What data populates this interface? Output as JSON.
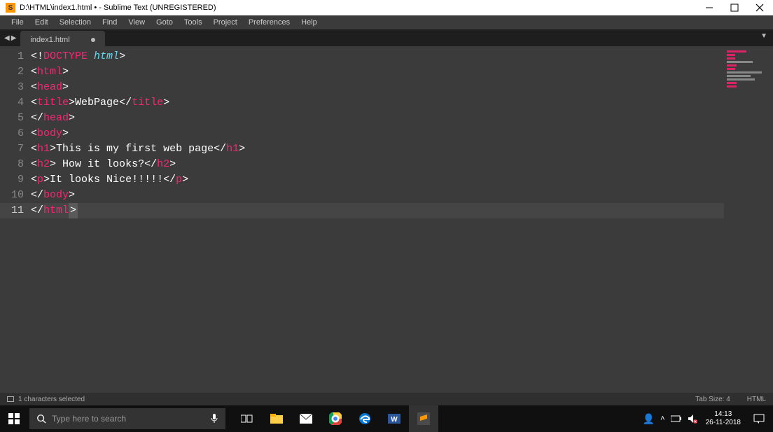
{
  "titlebar": {
    "title": "D:\\HTML\\index1.html • - Sublime Text (UNREGISTERED)",
    "app_icon_letter": "S"
  },
  "menubar": {
    "items": [
      "File",
      "Edit",
      "Selection",
      "Find",
      "View",
      "Goto",
      "Tools",
      "Project",
      "Preferences",
      "Help"
    ]
  },
  "tabs": {
    "active": {
      "label": "index1.html",
      "modified": true
    }
  },
  "code": {
    "lines": [
      {
        "n": 1,
        "tokens": [
          {
            "t": "<!",
            "c": "punc"
          },
          {
            "t": "DOCTYPE",
            "c": "tag"
          },
          {
            "t": " ",
            "c": "w"
          },
          {
            "t": "html",
            "c": "doctype"
          },
          {
            "t": ">",
            "c": "punc"
          }
        ]
      },
      {
        "n": 2,
        "tokens": [
          {
            "t": "<",
            "c": "punc"
          },
          {
            "t": "html",
            "c": "tag"
          },
          {
            "t": ">",
            "c": "punc"
          }
        ]
      },
      {
        "n": 3,
        "tokens": [
          {
            "t": "<",
            "c": "punc"
          },
          {
            "t": "head",
            "c": "tag"
          },
          {
            "t": ">",
            "c": "punc"
          }
        ]
      },
      {
        "n": 4,
        "tokens": [
          {
            "t": "<",
            "c": "punc"
          },
          {
            "t": "title",
            "c": "tag"
          },
          {
            "t": ">",
            "c": "punc"
          },
          {
            "t": "WebPage",
            "c": "w"
          },
          {
            "t": "</",
            "c": "punc"
          },
          {
            "t": "title",
            "c": "tag"
          },
          {
            "t": ">",
            "c": "punc"
          }
        ]
      },
      {
        "n": 5,
        "tokens": [
          {
            "t": "</",
            "c": "punc"
          },
          {
            "t": "head",
            "c": "tag"
          },
          {
            "t": ">",
            "c": "punc"
          }
        ]
      },
      {
        "n": 6,
        "tokens": [
          {
            "t": "<",
            "c": "punc"
          },
          {
            "t": "body",
            "c": "tag"
          },
          {
            "t": ">",
            "c": "punc"
          }
        ]
      },
      {
        "n": 7,
        "tokens": [
          {
            "t": "<",
            "c": "punc"
          },
          {
            "t": "h1",
            "c": "tag"
          },
          {
            "t": ">",
            "c": "punc"
          },
          {
            "t": "This is my first web page",
            "c": "w"
          },
          {
            "t": "</",
            "c": "punc"
          },
          {
            "t": "h1",
            "c": "tag"
          },
          {
            "t": ">",
            "c": "punc"
          }
        ]
      },
      {
        "n": 8,
        "tokens": [
          {
            "t": "<",
            "c": "punc"
          },
          {
            "t": "h2",
            "c": "tag"
          },
          {
            "t": ">",
            "c": "punc"
          },
          {
            "t": " How it looks?",
            "c": "w"
          },
          {
            "t": "</",
            "c": "punc"
          },
          {
            "t": "h2",
            "c": "tag"
          },
          {
            "t": ">",
            "c": "punc"
          }
        ]
      },
      {
        "n": 9,
        "tokens": [
          {
            "t": "<",
            "c": "punc"
          },
          {
            "t": "p",
            "c": "tag"
          },
          {
            "t": ">",
            "c": "punc"
          },
          {
            "t": "It looks Nice!!!!!",
            "c": "w"
          },
          {
            "t": "</",
            "c": "punc"
          },
          {
            "t": "p",
            "c": "tag"
          },
          {
            "t": ">",
            "c": "punc"
          }
        ]
      },
      {
        "n": 10,
        "tokens": [
          {
            "t": "</",
            "c": "punc"
          },
          {
            "t": "body",
            "c": "tag"
          },
          {
            "t": ">",
            "c": "punc"
          }
        ]
      },
      {
        "n": 11,
        "current": true,
        "tokens": [
          {
            "t": "</",
            "c": "punc"
          },
          {
            "t": "html",
            "c": "tag"
          },
          {
            "t": ">",
            "c": "sel-cursor"
          }
        ]
      }
    ]
  },
  "statusbar": {
    "selection": "1 characters selected",
    "tab_size": "Tab Size: 4",
    "syntax": "HTML"
  },
  "taskbar": {
    "search_placeholder": "Type here to search",
    "clock": {
      "time": "14:13",
      "date": "26-11-2018"
    }
  }
}
